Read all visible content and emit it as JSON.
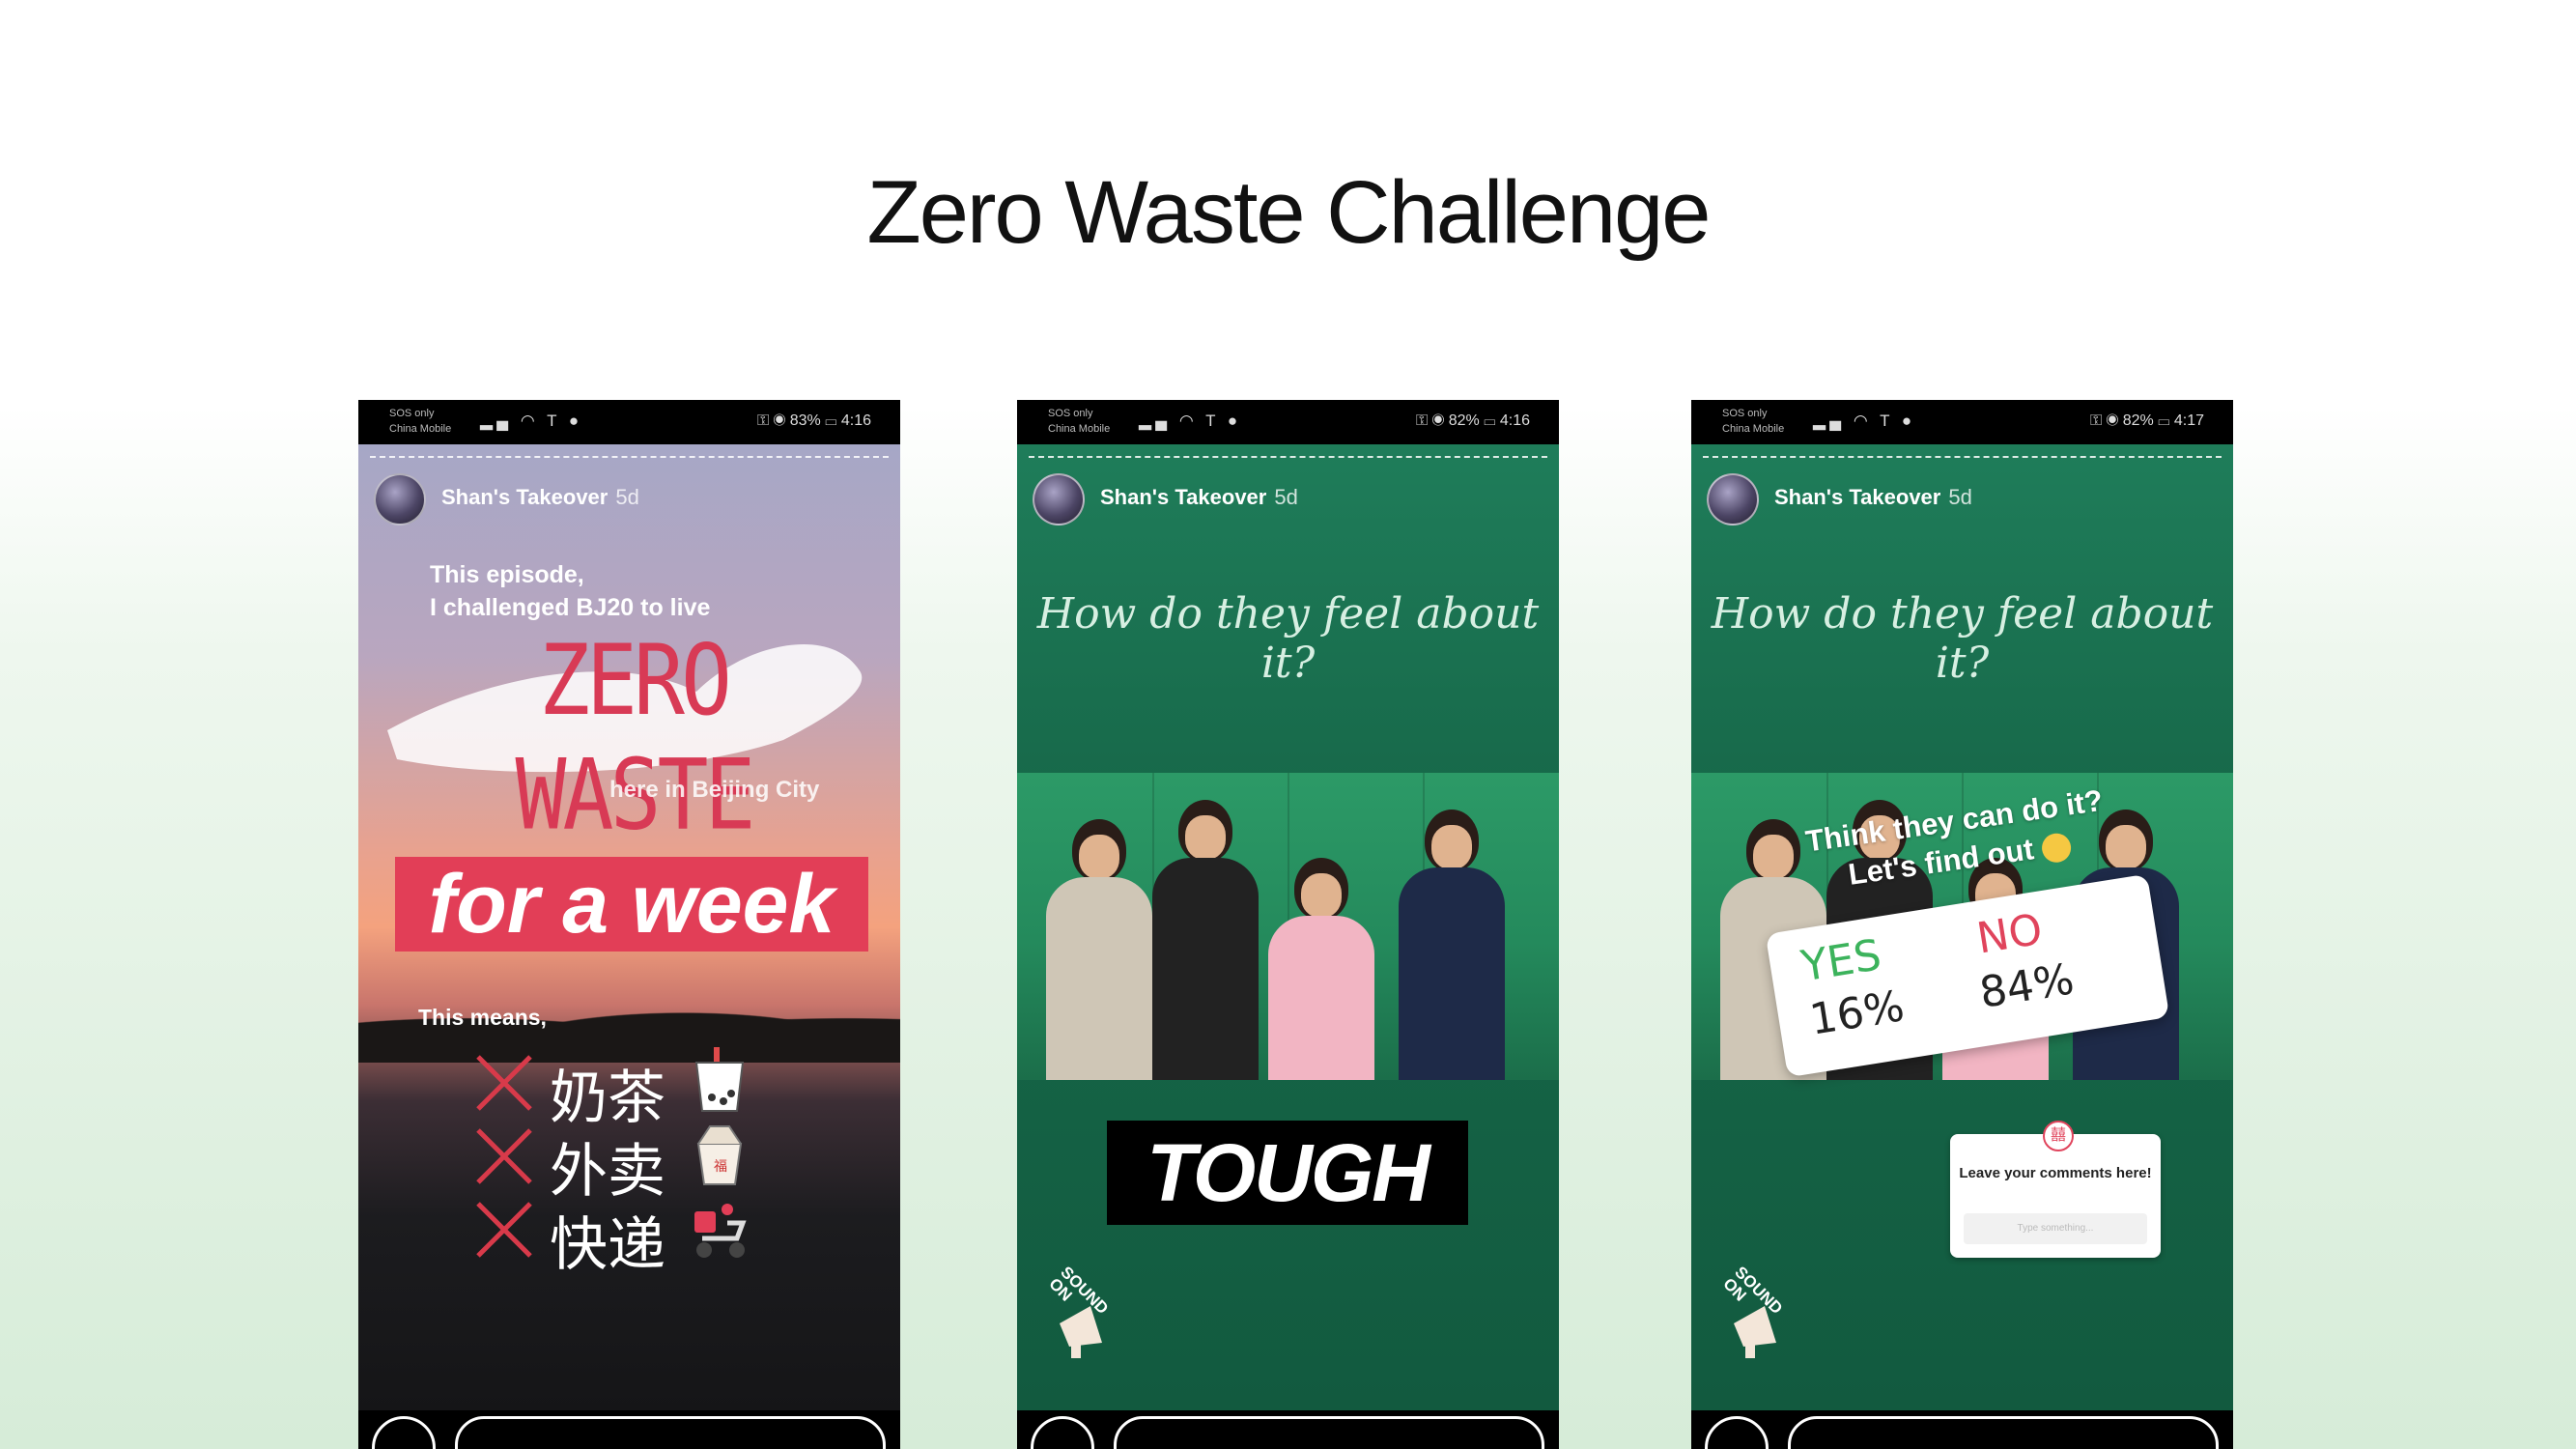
{
  "slide": {
    "title": "Zero Waste Challenge"
  },
  "phones": [
    {
      "status": {
        "carrier_top": "SOS only",
        "carrier_bottom": "China Mobile",
        "battery": "83%",
        "time": "4:16"
      },
      "story": {
        "account": "Shan's Takeover",
        "age": "5d"
      },
      "content": {
        "intro_line1": "This episode,",
        "intro_line2": "I challenged BJ20 to live",
        "headline": "ZERO WASTE",
        "location": "here in Beijing City",
        "banner": "for a week",
        "means": "This means,",
        "items": [
          "奶茶",
          "外卖",
          "快递"
        ]
      }
    },
    {
      "status": {
        "carrier_top": "SOS only",
        "carrier_bottom": "China Mobile",
        "battery": "82%",
        "time": "4:16"
      },
      "story": {
        "account": "Shan's Takeover",
        "age": "5d"
      },
      "content": {
        "question": "How do they feel about it?",
        "sticker": "TOUGH",
        "sound_label": "SOUND ON"
      }
    },
    {
      "status": {
        "carrier_top": "SOS only",
        "carrier_bottom": "China Mobile",
        "battery": "82%",
        "time": "4:17"
      },
      "story": {
        "account": "Shan's Takeover",
        "age": "5d"
      },
      "content": {
        "question": "How do they feel about it?",
        "poll_question_line1": "Think they can do it?",
        "poll_question_line2": "Let's find out",
        "poll_yes": "YES",
        "poll_yes_pct": "16%",
        "poll_no": "NO",
        "poll_no_pct": "84%",
        "comment_prompt": "Leave your comments here!",
        "comment_placeholder": "Type something...",
        "sound_label": "SOUND ON"
      }
    }
  ],
  "colors": {
    "accent_red": "#e23e57",
    "story_green": "#17694a",
    "poll_yes": "#3cb35c",
    "poll_no": "#e0445c"
  }
}
